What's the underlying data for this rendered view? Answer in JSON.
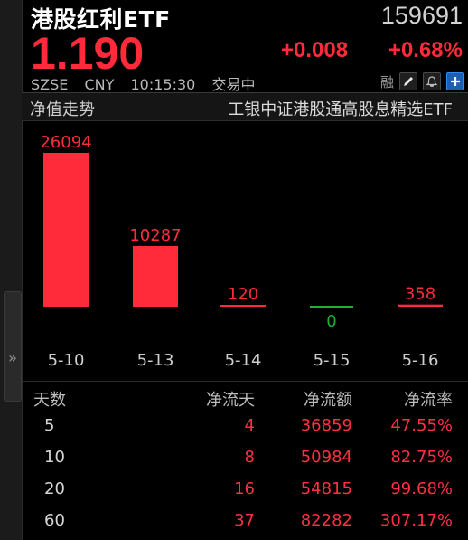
{
  "header": {
    "name": "港股红利ETF",
    "code": "159691",
    "price": "1.190",
    "change": "+0.008",
    "change_pct": "+0.68%",
    "exchange": "SZSE",
    "currency": "CNY",
    "time": "10:15:30",
    "trade_status": "交易中",
    "margin_label": "融",
    "icons": [
      "edit-icon",
      "bell-icon",
      "add-icon"
    ]
  },
  "section": {
    "title": "净值走势",
    "fund_name": "工银中证港股通高股息精选ETF"
  },
  "chart_data": {
    "type": "bar",
    "categories": [
      "5-10",
      "5-13",
      "5-14",
      "5-15",
      "5-16"
    ],
    "values": [
      26094,
      10287,
      120,
      0,
      358
    ],
    "value_labels": [
      "26094",
      "10287",
      "120",
      "0",
      "358"
    ],
    "title": "",
    "xlabel": "",
    "ylabel": "",
    "positive_color": "#ff2b3b",
    "zero_color": "#1fae3a"
  },
  "table": {
    "headers": [
      "天数",
      "净流天",
      "净流额",
      "净流率"
    ],
    "rows": [
      [
        "5",
        "4",
        "36859",
        "47.55%"
      ],
      [
        "10",
        "8",
        "50984",
        "82.75%"
      ],
      [
        "20",
        "16",
        "54815",
        "99.68%"
      ],
      [
        "60",
        "37",
        "82282",
        "307.17%"
      ]
    ]
  },
  "colors": {
    "up": "#ff2b3b",
    "background": "#000000",
    "accent": "#2d8cf0"
  }
}
